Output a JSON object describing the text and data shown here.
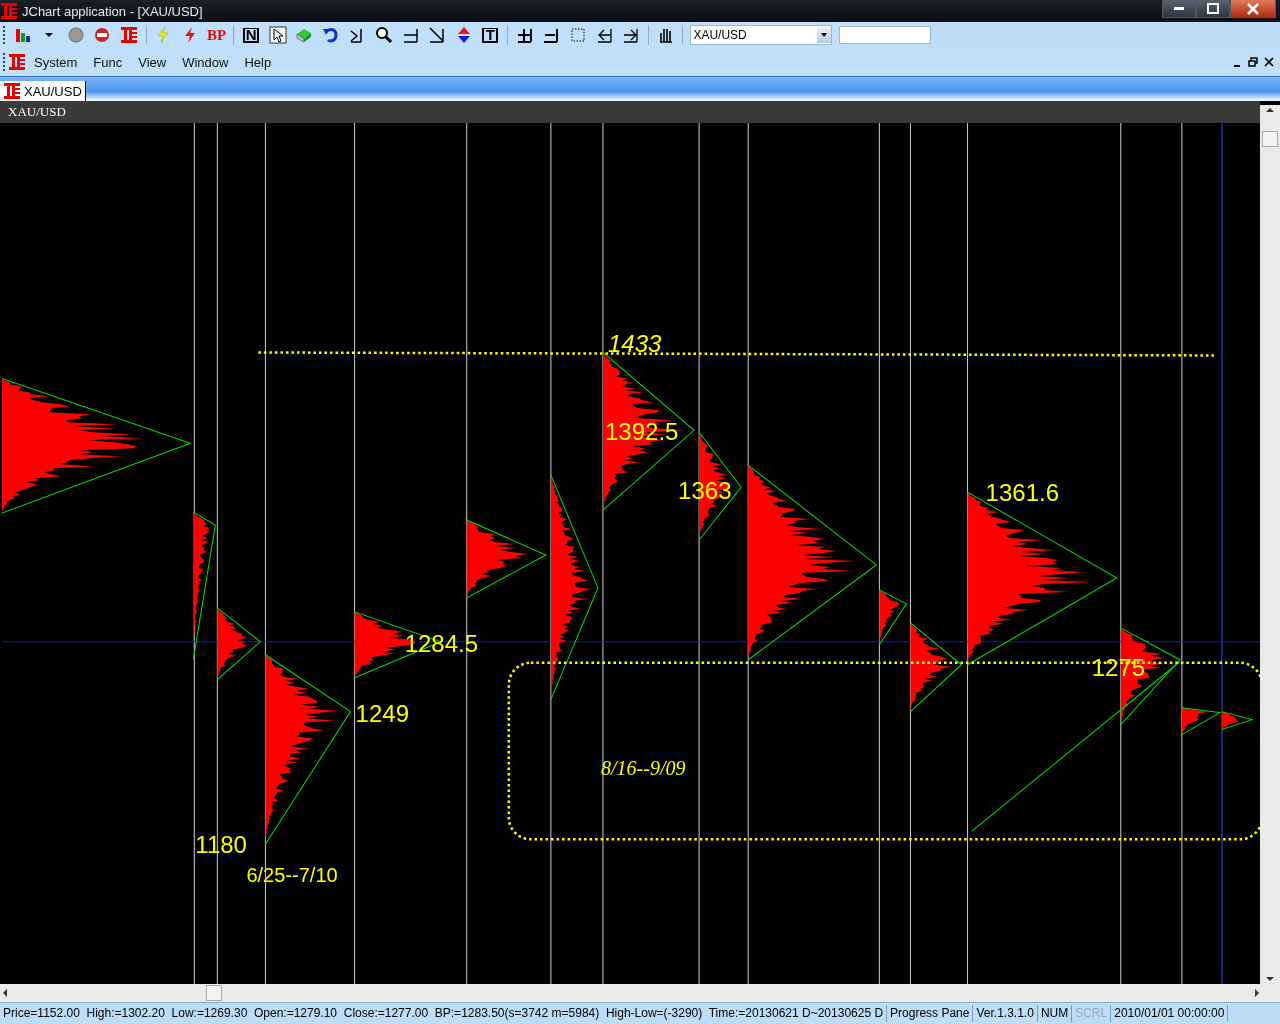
{
  "window": {
    "title": "JChart application - [XAU/USD]"
  },
  "toolbar": {
    "text_buttons": [
      "BP",
      "N",
      "T"
    ],
    "symbol_box": {
      "value": "XAU/USD"
    }
  },
  "menu": [
    "System",
    "Func",
    "View",
    "Window",
    "Help"
  ],
  "tabs": [
    {
      "label": "XAU/USD",
      "selected": true
    }
  ],
  "chart": {
    "title": "XAU/USD",
    "labels": [
      {
        "text": "1433",
        "italic": true
      },
      {
        "text": "1392.5",
        "italic": false
      },
      {
        "text": "1363",
        "italic": false
      },
      {
        "text": "1361.6",
        "italic": false
      },
      {
        "text": "1284.5",
        "italic": false
      },
      {
        "text": "1249",
        "italic": false
      },
      {
        "text": "1275",
        "italic": false
      },
      {
        "text": "1180",
        "italic": false
      },
      {
        "text": "6/25--7/10",
        "italic": false
      },
      {
        "text": "8/16--9/09",
        "italic": true
      }
    ]
  },
  "status_bar": [
    {
      "text": "Price=1152.00  High:=1302.20  Low:=1269.30  Open:=1279.10  Close:=1277.00  BP:=1283.50(s=3742 m=5984)  High-Low=(-3290)  Time:=20130621 D~20130625 D",
      "disabled": false
    },
    {
      "text": "Progress Pane",
      "disabled": false
    },
    {
      "text": "Ver.1.3.1.0",
      "disabled": false
    },
    {
      "text": "NUM",
      "disabled": false
    },
    {
      "text": "SCRL",
      "disabled": true
    },
    {
      "text": "2010/01/01 00:00:00",
      "disabled": false
    }
  ]
}
